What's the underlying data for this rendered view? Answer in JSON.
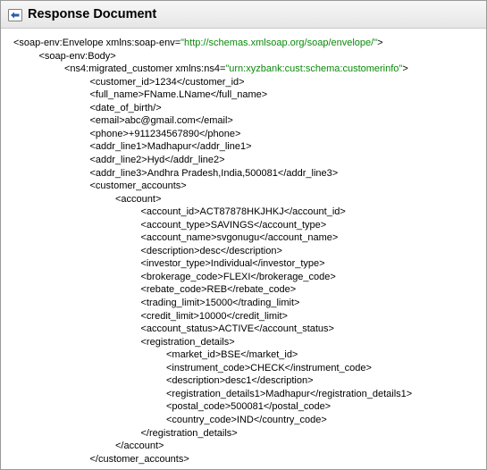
{
  "window": {
    "title": "Response Document",
    "icon": "back-arrow-icon",
    "colors": {
      "tag": "#000000",
      "attribute_value": "#0a8a0a",
      "icon_arrow": "#2a5fb0"
    }
  },
  "xml": {
    "lines": [
      {
        "indent": 0,
        "parts": [
          "<soap-env:Envelope xmlns:soap-env=",
          "\"http://schemas.xmlsoap.org/soap/envelope/\"",
          ">"
        ]
      },
      {
        "indent": 1,
        "parts": [
          "<soap-env:Body>"
        ]
      },
      {
        "indent": 2,
        "parts": [
          "<ns4:migrated_customer xmlns:ns4=",
          "\"urn:xyzbank:cust:schema:customerinfo\"",
          ">"
        ]
      },
      {
        "indent": 3,
        "parts": [
          "<customer_id>1234</customer_id>"
        ]
      },
      {
        "indent": 3,
        "parts": [
          "<full_name>FName.LName</full_name>"
        ]
      },
      {
        "indent": 3,
        "parts": [
          "<date_of_birth/>"
        ]
      },
      {
        "indent": 3,
        "parts": [
          "<email>abc@gmail.com</email>"
        ]
      },
      {
        "indent": 3,
        "parts": [
          "<phone>+911234567890</phone>"
        ]
      },
      {
        "indent": 3,
        "parts": [
          "<addr_line1>Madhapur</addr_line1>"
        ]
      },
      {
        "indent": 3,
        "parts": [
          "<addr_line2>Hyd</addr_line2>"
        ]
      },
      {
        "indent": 3,
        "parts": [
          "<addr_line3>Andhra Pradesh,India,500081</addr_line3>"
        ]
      },
      {
        "indent": 3,
        "parts": [
          "<customer_accounts>"
        ]
      },
      {
        "indent": 4,
        "parts": [
          "<account>"
        ]
      },
      {
        "indent": 5,
        "parts": [
          "<account_id>ACT87878HKJHKJ</account_id>"
        ]
      },
      {
        "indent": 5,
        "parts": [
          "<account_type>SAVINGS</account_type>"
        ]
      },
      {
        "indent": 5,
        "parts": [
          "<account_name>svgonugu</account_name>"
        ]
      },
      {
        "indent": 5,
        "parts": [
          "<description>desc</description>"
        ]
      },
      {
        "indent": 5,
        "parts": [
          "<investor_type>Individual</investor_type>"
        ]
      },
      {
        "indent": 5,
        "parts": [
          "<brokerage_code>FLEXI</brokerage_code>"
        ]
      },
      {
        "indent": 5,
        "parts": [
          "<rebate_code>REB</rebate_code>"
        ]
      },
      {
        "indent": 5,
        "parts": [
          "<trading_limit>15000</trading_limit>"
        ]
      },
      {
        "indent": 5,
        "parts": [
          "<credit_limit>10000</credit_limit>"
        ]
      },
      {
        "indent": 5,
        "parts": [
          "<account_status>ACTIVE</account_status>"
        ]
      },
      {
        "indent": 5,
        "parts": [
          "<registration_details>"
        ]
      },
      {
        "indent": 6,
        "parts": [
          "<market_id>BSE</market_id>"
        ]
      },
      {
        "indent": 6,
        "parts": [
          "<instrument_code>CHECK</instrument_code>"
        ]
      },
      {
        "indent": 6,
        "parts": [
          "<description>desc1</description>"
        ]
      },
      {
        "indent": 6,
        "parts": [
          "<registration_details1>Madhapur</registration_details1>"
        ]
      },
      {
        "indent": 6,
        "parts": [
          "<postal_code>500081</postal_code>"
        ]
      },
      {
        "indent": 6,
        "parts": [
          "<country_code>IND</country_code>"
        ]
      },
      {
        "indent": 5,
        "parts": [
          "</registration_details>"
        ]
      },
      {
        "indent": 4,
        "parts": [
          "</account>"
        ]
      },
      {
        "indent": 3,
        "parts": [
          "</customer_accounts>"
        ]
      }
    ]
  }
}
